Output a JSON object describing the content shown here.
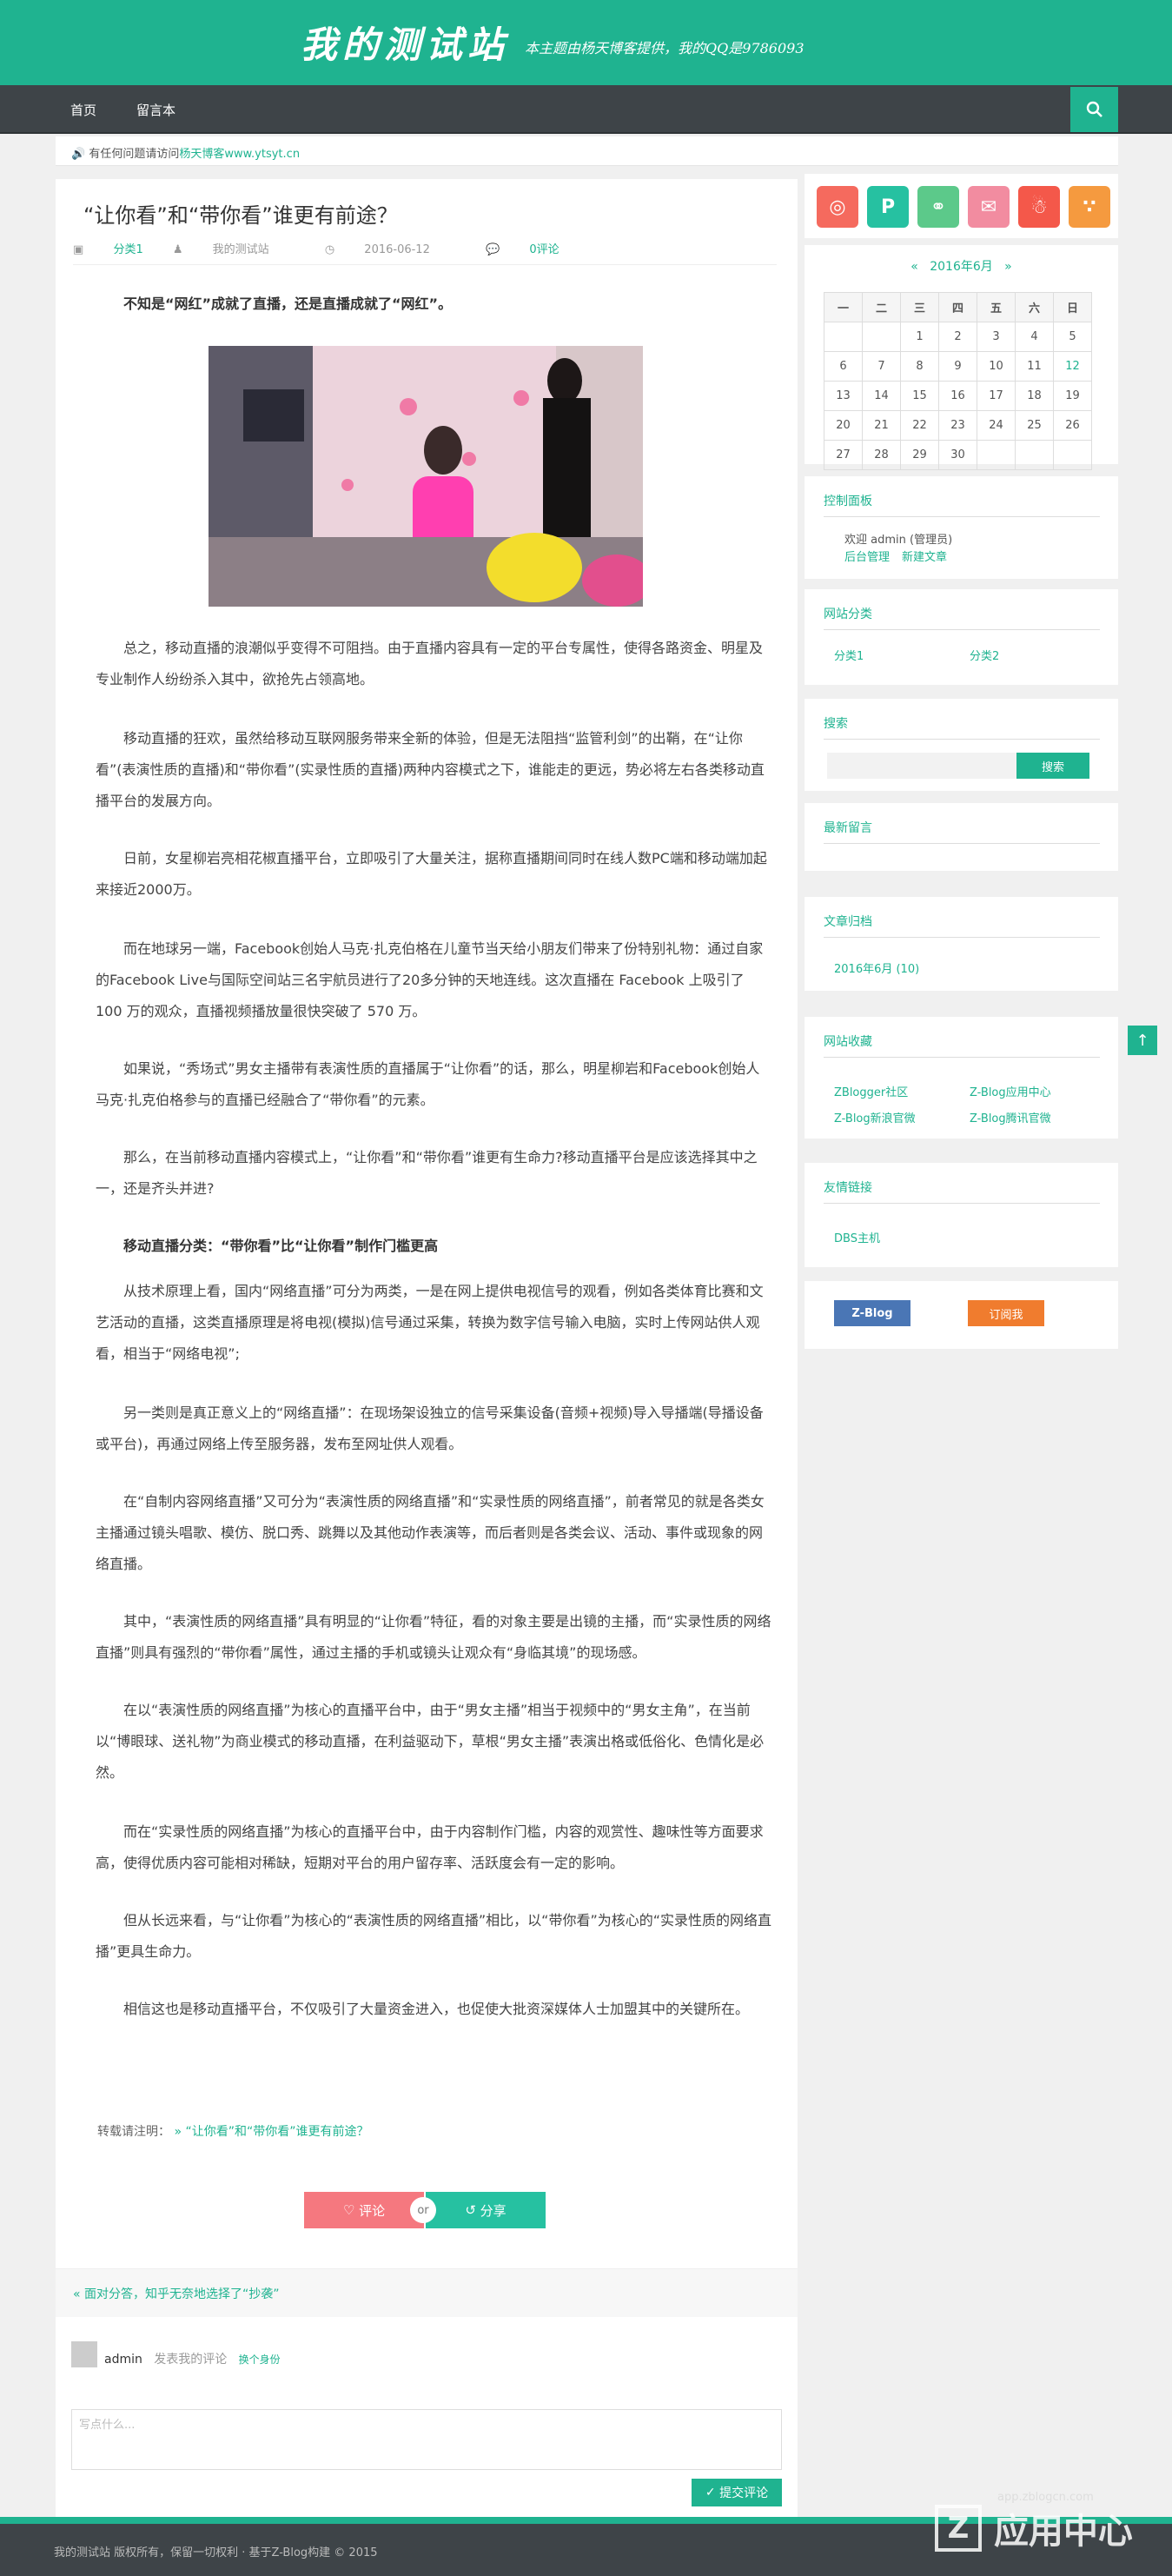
{
  "site": {
    "title": "我的测试站",
    "tagline": "本主题由杨天博客提供，我的QQ是9786093"
  },
  "nav": {
    "items": [
      "首页",
      "留言本"
    ]
  },
  "notice": {
    "text": "有任何问题请访问",
    "link": "杨天博客www.ytsyt.cn"
  },
  "post": {
    "title": "“让你看”和“带你看”谁更有前途？",
    "category": "分类1",
    "author": "我的测试站",
    "date": "2016-06-12",
    "comments": "0评论",
    "lead": "不知是“网红”成就了直播，还是直播成就了“网红”。",
    "paragraphs": [
      "总之，移动直播的浪潮似乎变得不可阻挡。由于直播内容具有一定的平台专属性，使得各路资金、明星及专业制作人纷纷杀入其中，欲抢先占领高地。",
      "移动直播的狂欢，虽然给移动互联网服务带来全新的体验，但是无法阻挡“监管利剑”的出鞘，在“让你看”(表演性质的直播)和“带你看”(实录性质的直播)两种内容模式之下，谁能走的更远，势必将左右各类移动直播平台的发展方向。",
      "日前，女星柳岩亮相花椒直播平台，立即吸引了大量关注，据称直播期间同时在线人数PC端和移动端加起来接近2000万。",
      "而在地球另一端，Facebook创始人马克·扎克伯格在儿童节当天给小朋友们带来了份特别礼物：通过自家的Facebook Live与国际空间站三名宇航员进行了20多分钟的天地连线。这次直播在 Facebook 上吸引了 100 万的观众，直播视频播放量很快突破了 570 万。",
      "如果说，“秀场式”男女主播带有表演性质的直播属于“让你看”的话，那么，明星柳岩和Facebook创始人马克·扎克伯格参与的直播已经融合了“带你看”的元素。",
      "那么，在当前移动直播内容模式上，“让你看”和“带你看”谁更有生命力?移动直播平台是应该选择其中之一，还是齐头并进?",
      "移动直播分类：“带你看”比“让你看”制作门槛更高",
      "从技术原理上看，国内“网络直播”可分为两类，一是在网上提供电视信号的观看，例如各类体育比赛和文艺活动的直播，这类直播原理是将电视(模拟)信号通过采集，转换为数字信号输入电脑，实时上传网站供人观看，相当于“网络电视”;",
      "另一类则是真正意义上的“网络直播”：在现场架设独立的信号采集设备(音频+视频)导入导播端(导播设备或平台)，再通过网络上传至服务器，发布至网址供人观看。",
      "在“自制内容网络直播”又可分为“表演性质的网络直播”和“实录性质的网络直播”，前者常见的就是各类女主播通过镜头唱歌、模仿、脱口秀、跳舞以及其他动作表演等，而后者则是各类会议、活动、事件或现象的网络直播。",
      "其中，“表演性质的网络直播”具有明显的“让你看”特征，看的对象主要是出镜的主播，而“实录性质的网络直播”则具有强烈的“带你看”属性，通过主播的手机或镜头让观众有“身临其境”的现场感。",
      "在以“表演性质的网络直播”为核心的直播平台中，由于“男女主播”相当于视频中的“男女主角”，在当前以“博眼球、送礼物”为商业模式的移动直播，在利益驱动下，草根“男女主播”表演出格或低俗化、色情化是必然。",
      "而在“实录性质的网络直播”为核心的直播平台中，由于内容制作门槛，内容的观赏性、趣味性等方面要求高，使得优质内容可能相对稀缺，短期对平台的用户留存率、活跃度会有一定的影响。",
      "但从长远来看，与“让你看”为核心的“表演性质的网络直播”相比，以“带你看”为核心的“实录性质的网络直播”更具生命力。",
      "相信这也是移动直播平台，不仅吸引了大量资金进入，也促使大批资深媒体人士加盟其中的关键所在。"
    ],
    "repost_label": "转载请注明：",
    "repost_link": "» “让你看”和“带你看”谁更有前途？",
    "comment_btn": "评论",
    "or": "or",
    "share_btn": "分享",
    "prev": "« 面对分答，知乎无奈地选择了“抄袭”"
  },
  "comment": {
    "user": "admin",
    "hint": "发表我的评论",
    "switch": "换个身份",
    "placeholder": "写点什么...",
    "submit": "提交评论"
  },
  "sidebar": {
    "social": [
      "weibo",
      "pinterest",
      "wechat",
      "mail",
      "qq",
      "rss"
    ],
    "calendar": {
      "prev": "«",
      "month": "2016年6月",
      "next": "»",
      "weekdays": [
        "一",
        "二",
        "三",
        "四",
        "五",
        "六",
        "日"
      ],
      "rows": [
        [
          "",
          "",
          "1",
          "2",
          "3",
          "4",
          "5"
        ],
        [
          "6",
          "7",
          "8",
          "9",
          "10",
          "11",
          "12"
        ],
        [
          "13",
          "14",
          "15",
          "16",
          "17",
          "18",
          "19"
        ],
        [
          "20",
          "21",
          "22",
          "23",
          "24",
          "25",
          "26"
        ],
        [
          "27",
          "28",
          "29",
          "30",
          "",
          "",
          ""
        ]
      ]
    },
    "control": {
      "title": "控制面板",
      "welcome": "欢迎 admin (管理员)",
      "admin": "后台管理",
      "new": "新建文章"
    },
    "cats": {
      "title": "网站分类",
      "items": [
        "分类1",
        "分类2"
      ]
    },
    "search": {
      "title": "搜索",
      "btn": "搜索"
    },
    "recent": {
      "title": "最新留言"
    },
    "archive": {
      "title": "文章归档",
      "items": [
        "2016年6月 (10)"
      ]
    },
    "favs": {
      "title": "网站收藏",
      "items": [
        "ZBlogger社区",
        "Z-Blog应用中心",
        "Z-Blog新浪官微",
        "Z-Blog腾讯官微"
      ]
    },
    "links": {
      "title": "友情链接",
      "items": [
        "DBS主机"
      ]
    },
    "badges": [
      "Z-Blog",
      "订阅我"
    ]
  },
  "footer": {
    "text": "我的测试站 版权所有，保留一切权利 · 基于Z-Blog构建 © 2015"
  },
  "watermark": {
    "big": "应用中心",
    "small": "app.zblogcn.com"
  },
  "colors": {
    "accent": "#1fb390",
    "nav": "#3e4448"
  }
}
